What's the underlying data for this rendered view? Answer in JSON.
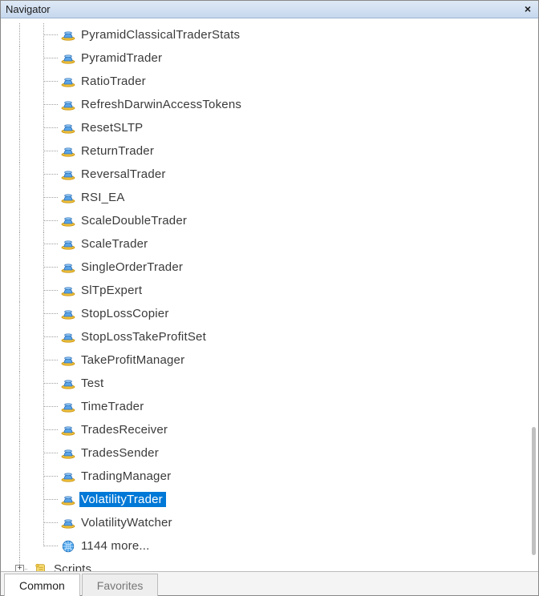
{
  "window": {
    "title": "Navigator",
    "close_glyph": "×"
  },
  "tree": {
    "experts": [
      {
        "label": "PyramidClassicalTraderStats",
        "icon": "hat"
      },
      {
        "label": "PyramidTrader",
        "icon": "hat"
      },
      {
        "label": "RatioTrader",
        "icon": "hat"
      },
      {
        "label": "RefreshDarwinAccessTokens",
        "icon": "hat"
      },
      {
        "label": "ResetSLTP",
        "icon": "hat"
      },
      {
        "label": "ReturnTrader",
        "icon": "hat"
      },
      {
        "label": "ReversalTrader",
        "icon": "hat"
      },
      {
        "label": "RSI_EA",
        "icon": "hat"
      },
      {
        "label": "ScaleDoubleTrader",
        "icon": "hat"
      },
      {
        "label": "ScaleTrader",
        "icon": "hat"
      },
      {
        "label": "SingleOrderTrader",
        "icon": "hat"
      },
      {
        "label": "SlTpExpert",
        "icon": "hat"
      },
      {
        "label": "StopLossCopier",
        "icon": "hat"
      },
      {
        "label": "StopLossTakeProfitSet",
        "icon": "hat"
      },
      {
        "label": "TakeProfitManager",
        "icon": "hat"
      },
      {
        "label": "Test",
        "icon": "hat"
      },
      {
        "label": "TimeTrader",
        "icon": "hat"
      },
      {
        "label": "TradesReceiver",
        "icon": "hat"
      },
      {
        "label": "TradesSender",
        "icon": "hat"
      },
      {
        "label": "TradingManager",
        "icon": "hat"
      },
      {
        "label": "VolatilityTrader",
        "icon": "hat",
        "selected": true
      },
      {
        "label": "VolatilityWatcher",
        "icon": "hat"
      },
      {
        "label": "1144 more...",
        "icon": "globe"
      }
    ],
    "scripts_label": "Scripts",
    "expand_glyph": "+"
  },
  "tabs": {
    "common": "Common",
    "favorites": "Favorites",
    "active": "common"
  },
  "colors": {
    "selection": "#0078d7"
  }
}
